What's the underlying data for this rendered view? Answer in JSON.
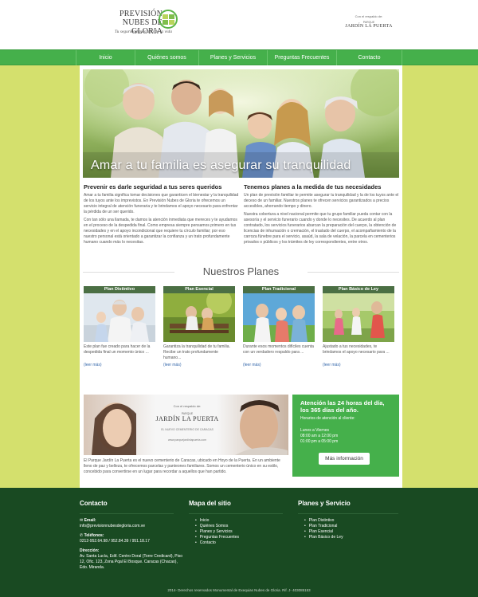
{
  "header": {
    "logo_line1": "PREVISIÓN",
    "logo_line2": "NUBES DE GLORIA",
    "tagline": "Tu seguridad más allá de la vida",
    "partner_caption": "Con el respaldo de:",
    "partner_name": "JARDÍN LA PUERTA",
    "partner_prefix": "PARQUE"
  },
  "nav": {
    "items": [
      "Inicio",
      "Quiénes somos",
      "Planes y Servicios",
      "Preguntas Frecuentes",
      "Contacto"
    ]
  },
  "hero": {
    "caption": "Amar a tu familia es asegurar su tranquilidad"
  },
  "intro": {
    "left_title": "Prevenir es darle seguridad a tus seres queridos",
    "left_p1": "Amar a tu familia significa tomar decisiones que garanticen el bienestar y la tranquilidad de los tuyos ante los imprevistos. En Previsión Nubes de Gloria te ofrecemos un servicio integral de atención funeraria y te brindamos el apoyo necesario para enfrentar la pérdida de un ser querido.",
    "left_p2": "Con tan sólo una llamada, te damos la atención inmediata que mereces y te ayudamos en el proceso de la despedida final. Como empresa siempre pensamos primero en tus necesidades y en el apoyo incondicional que requiere tu círculo familiar; por eso nuestro personal está orientado a garantizar la confianza y un trato profundamente humano cuando más lo necesitas.",
    "right_title": "Tenemos planes a la medida de tus necesidades",
    "right_p1": "Un plan de previsión familiar te permite asegurar tu tranquilidad y la de los tuyos ante el deceso de un familiar. Nuestros planes te ofrecen servicios garantizados a precios accesibles, ahorrando tiempo y dinero.",
    "right_p2": "Nuestra cobertura a nivel nacional permite que tu grupo familiar pueda contar con la asesoría y el servicio funerario cuando y donde lo necesites. De acuerdo al plan contratado, los servicios funerarios abarcan la preparación del cuerpo, la obtención de licencias de inhumación o cremación, el traslado del cuerpo, el acompañamiento de la carroza fúnebre para el servicio, asaúd, la sala de velación, la parcela en cementerios privados o públicos y los trámites de ley correspondientes, entre otros."
  },
  "planes": {
    "title": "Nuestros Planes",
    "more_label": "(leer más)",
    "items": [
      {
        "name": "Plan Distintivo",
        "desc": "Este plan fue creado para hacer de la despedida final un momento único ..."
      },
      {
        "name": "Plan Esencial",
        "desc": "Garantiza la tranquilidad de tu familia. Recibe un trato profundamente humano..."
      },
      {
        "name": "Plan Tradicional",
        "desc": "Durante esos momentos difíciles cuenta con un verdadero respaldo para ..."
      },
      {
        "name": "Plan Básico de Ley",
        "desc": "Ajustado a tus necesidades, te brindamos el apoyo necesario para ..."
      }
    ]
  },
  "banner": {
    "caption": "Con el respaldo de:",
    "brand_prefix": "PARQUE",
    "brand": "JARDÍN LA PUERTA",
    "sub": "EL NUEVO CEMENTERIO DE CARACAS",
    "url": "www.parquejardinlapuerta.com",
    "text": "El Parque Jardín La Puerta es el nuevo cementerio de Caracas, ubicado en Hoyo de la Puerta. En un ambiente lleno de paz y belleza, te ofrecemos parcelas y panteones familiares. Somos un cementerio único en su estilo, concebido para convertirse en un lugar para recordar a aquellos que han partido."
  },
  "attention": {
    "title": "Atención las 24 horas del día, los 365 días del año.",
    "hours_label": "Horarios de atención al cliente:",
    "days": "Lunes a Viernes",
    "hours1": "08:00 am a 12:00 pm",
    "hours2": "01:00 pm a 05:00 pm",
    "button": "Más información"
  },
  "footer": {
    "contact_title": "Contacto",
    "email_label": "Email:",
    "email": "info@previsionnubesdegloria.com.ve",
    "phone_label": "Teléfonos:",
    "phones": "0212-952.64.98 / 952.84.39 / 951.18.17",
    "address_label": "Dirección:",
    "address": "Av. Santa Lucía, Edif. Centro Doral (Torre Credicard), Piso 12, Ofic. 123, Zona Pqal El Bosque. Caracas (Chacao), Edo. Miranda.",
    "map_title": "Mapa del sitio",
    "map_items": [
      "Inicio",
      "Quiénes Somos",
      "Planes y Servicios",
      "Preguntas Frecuentes",
      "Contacto"
    ],
    "services_title": "Planes y Servicio",
    "service_items": [
      "Plan Distintivo",
      "Plan Tradicional",
      "Plan Esencial",
      "Plan Básico de Ley"
    ],
    "copyright": "2014- Derechos reservados Monumental de Exequias Nubes de Gloria. Rif. J- 403085153"
  }
}
